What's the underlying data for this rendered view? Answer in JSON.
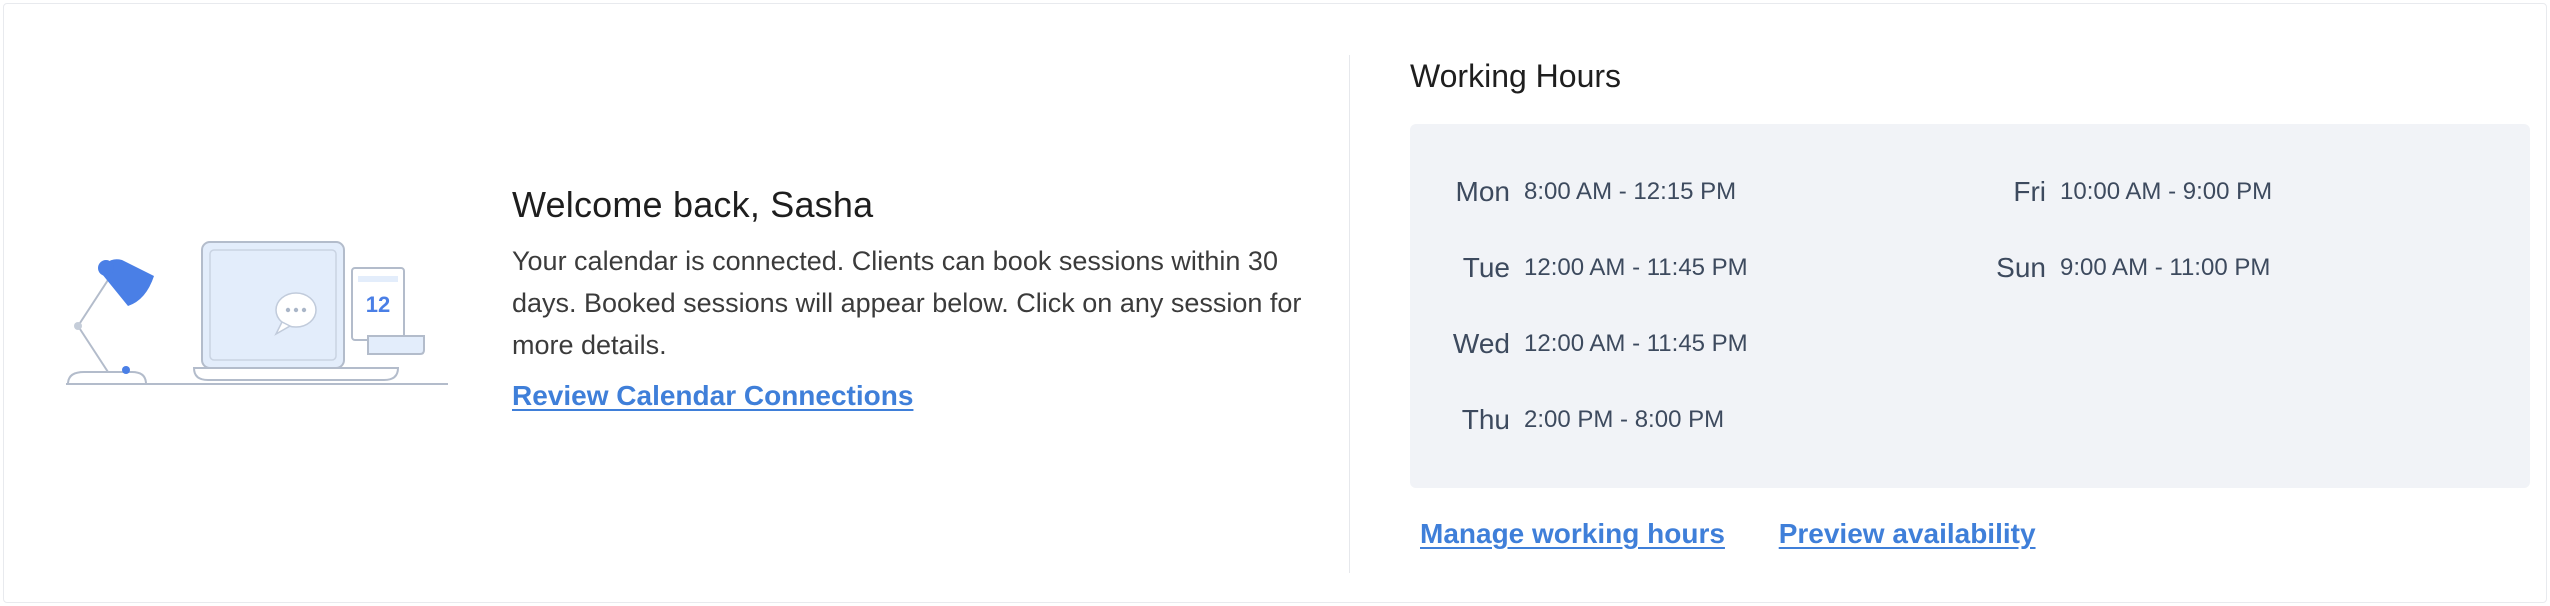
{
  "welcome": {
    "heading": "Welcome back, Sasha",
    "body": "Your calendar is connected. Clients can book sessions within 30 days. Booked sessions will appear below. Click on any session for more details.",
    "review_link": "Review Calendar Connections"
  },
  "illustration": {
    "calendar_day": "12",
    "icons": [
      "desk-lamp-icon",
      "laptop-icon",
      "chat-bubble-icon",
      "calendar-icon"
    ]
  },
  "working_hours": {
    "title": "Working Hours",
    "left_column": [
      {
        "day": "Mon",
        "hours": "8:00 AM - 12:15 PM"
      },
      {
        "day": "Tue",
        "hours": "12:00 AM - 11:45 PM"
      },
      {
        "day": "Wed",
        "hours": "12:00 AM - 11:45 PM"
      },
      {
        "day": "Thu",
        "hours": "2:00 PM - 8:00 PM"
      }
    ],
    "right_column": [
      {
        "day": "Fri",
        "hours": "10:00 AM - 9:00 PM"
      },
      {
        "day": "Sun",
        "hours": "9:00 AM - 11:00 PM"
      }
    ],
    "manage_link": "Manage working hours",
    "preview_link": "Preview availability"
  },
  "colors": {
    "link": "#3f7fd9",
    "accent_blue": "#4a7fe6",
    "panel_bg": "#f1f3f7",
    "illustration_light": "#e3edfb",
    "illustration_line": "#b3bccb"
  }
}
